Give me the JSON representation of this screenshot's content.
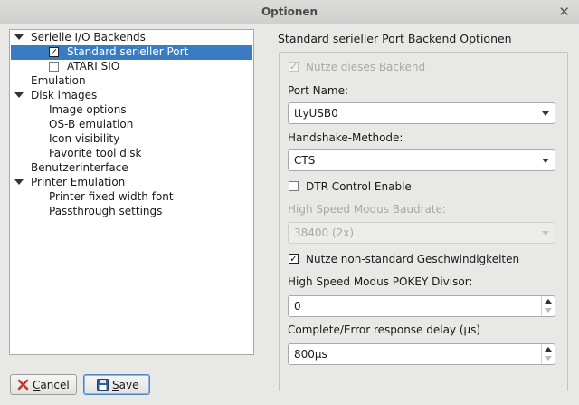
{
  "window": {
    "title": "Optionen",
    "close_glyph": "✕"
  },
  "tree": {
    "items": [
      {
        "label": "Serielle I/O Backends"
      },
      {
        "label": "Standard serieller Port",
        "checked": true,
        "selected": true
      },
      {
        "label": "ATARI SIO",
        "checked": false
      },
      {
        "label": "Emulation"
      },
      {
        "label": "Disk images"
      },
      {
        "label": "Image options"
      },
      {
        "label": "OS-B emulation"
      },
      {
        "label": "Icon visibility"
      },
      {
        "label": "Favorite tool disk"
      },
      {
        "label": "Benutzerinterface"
      },
      {
        "label": "Printer Emulation"
      },
      {
        "label": "Printer fixed width font"
      },
      {
        "label": "Passthrough settings"
      }
    ]
  },
  "panel": {
    "heading": "Standard serieller Port Backend Optionen",
    "use_backend": {
      "label": "Nutze dieses Backend",
      "checked": true,
      "enabled": false
    },
    "port_name": {
      "label": "Port Name:",
      "value": "ttyUSB0"
    },
    "handshake": {
      "label": "Handshake-Methode:",
      "value": "CTS"
    },
    "dtr": {
      "label": "DTR Control Enable",
      "checked": false
    },
    "baud": {
      "label": "High Speed Modus Baudrate:",
      "value": "38400 (2x)",
      "enabled": false
    },
    "nonstandard": {
      "label": "Nutze non-standard Geschwindigkeiten",
      "checked": true
    },
    "pokey": {
      "label": "High Speed Modus POKEY Divisor:",
      "value": "0"
    },
    "delay": {
      "label": "Complete/Error response delay (µs)",
      "value": "800µs"
    }
  },
  "buttons": {
    "cancel": {
      "label": "Cancel",
      "icon": "cancel-x-icon"
    },
    "save": {
      "label": "Save",
      "icon": "floppy-disk-icon"
    }
  },
  "colors": {
    "selection": "#3a7cc4",
    "accent_focus": "#4a86c8",
    "cancel_icon": "#c0392b",
    "save_icon": "#2f5f9e"
  }
}
